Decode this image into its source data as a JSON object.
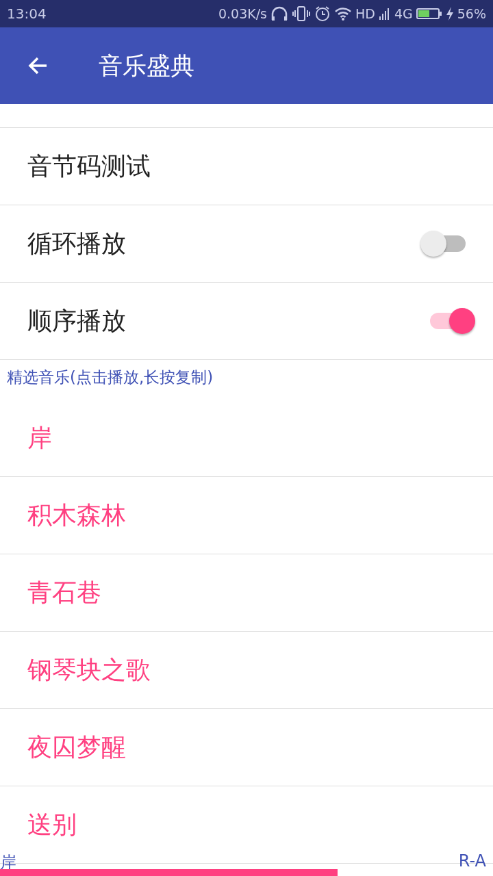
{
  "status_bar": {
    "time": "13:04",
    "speed": "0.03K/s",
    "network": "HD",
    "network_type": "4G",
    "battery": "56%"
  },
  "app_bar": {
    "title": "音乐盛典"
  },
  "settings": [
    {
      "kind": "text",
      "label": "音节码测试"
    },
    {
      "kind": "switch",
      "label": "循环播放",
      "on": false
    },
    {
      "kind": "switch",
      "label": "顺序播放",
      "on": true
    }
  ],
  "section_header": "精选音乐(点击播放,长按复制)",
  "songs": [
    "岸",
    "积木森林",
    "青石巷",
    "钢琴块之歌",
    "夜囚梦醒",
    "送别"
  ],
  "player": {
    "title": "岸",
    "mode": "R-A",
    "level": 0.685
  }
}
